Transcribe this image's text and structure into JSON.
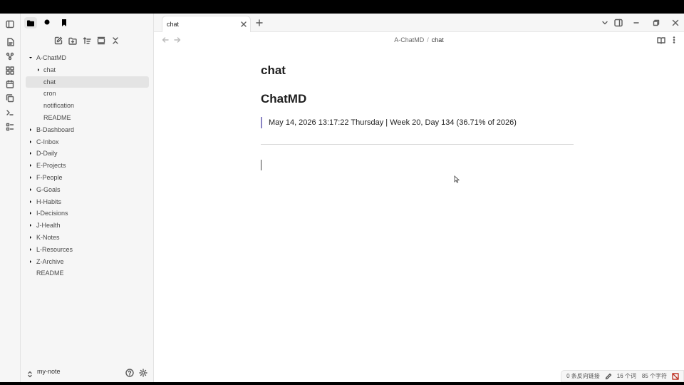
{
  "tab": {
    "title": "chat"
  },
  "breadcrumb": {
    "parent": "A-ChatMD",
    "separator": "/",
    "current": "chat"
  },
  "tree": {
    "root": "A-ChatMD",
    "children": [
      "chat",
      "chat",
      "cron",
      "notification",
      "README"
    ],
    "folders": [
      "B-Dashboard",
      "C-Inbox",
      "D-Daily",
      "E-Projects",
      "F-People",
      "G-Goals",
      "H-Habits",
      "I-Decisions",
      "J-Health",
      "K-Notes",
      "L-Resources",
      "Z-Archive"
    ],
    "root_file": "README"
  },
  "vault": {
    "name": "my-note"
  },
  "document": {
    "title": "chat",
    "heading": "ChatMD",
    "quote": "May 14, 2026 13:17:22 Thursday | Week 20, Day 134 (36.71% of 2026)"
  },
  "status": {
    "backlinks": "0 条反向链接",
    "words": "16 个词",
    "chars": "85 个字符"
  },
  "colors": {
    "accent": "#8a84c4",
    "sidebar_bg": "#f6f6f6"
  },
  "icons": [
    "sidebar-toggle-icon",
    "folder-icon",
    "search-icon",
    "bookmark-icon",
    "file-icon",
    "graph-icon",
    "canvas-icon",
    "calendar-icon",
    "copy-icon",
    "terminal-icon",
    "list-icon",
    "new-note-icon",
    "new-folder-icon",
    "sort-icon",
    "collapse-icon",
    "close-all-icon",
    "reading-mode-icon",
    "more-icon"
  ]
}
